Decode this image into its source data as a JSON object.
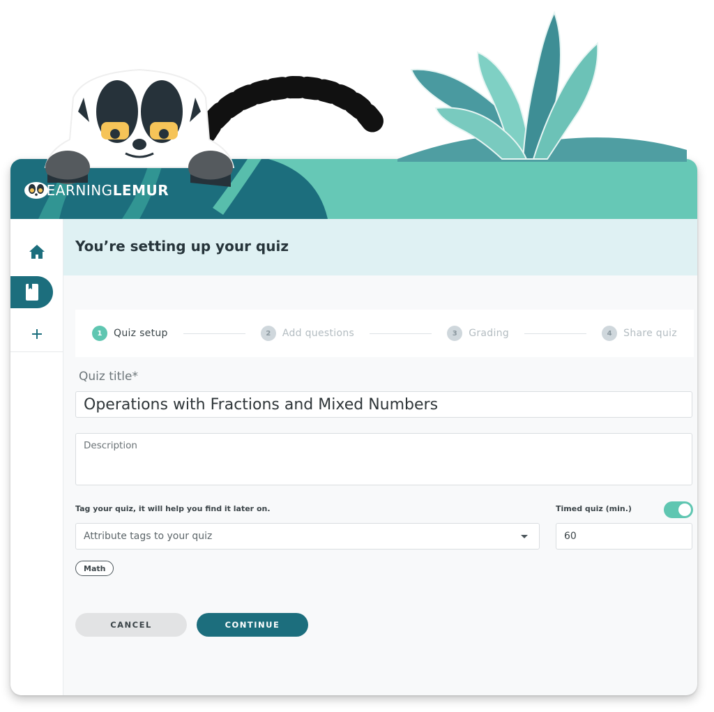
{
  "brand": {
    "name_light": "LEARNING",
    "name_bold": "LEMUR",
    "logo_icon": "lemur-face-icon"
  },
  "colors": {
    "primary": "#1c6e7d",
    "accent": "#5fc6b1",
    "header_bg": "#66c8b6",
    "page_header_bg": "#dff1f3"
  },
  "sidebar": {
    "items": [
      {
        "name": "home",
        "icon": "home-icon",
        "active": false
      },
      {
        "name": "quizzes",
        "icon": "book-icon",
        "active": true
      },
      {
        "name": "add",
        "icon": "plus-icon",
        "active": false
      }
    ]
  },
  "page": {
    "title": "You’re setting up your quiz"
  },
  "stepper": {
    "steps": [
      {
        "number": "1",
        "label": "Quiz setup",
        "active": true
      },
      {
        "number": "2",
        "label": "Add questions",
        "active": false
      },
      {
        "number": "3",
        "label": "Grading",
        "active": false
      },
      {
        "number": "4",
        "label": "Share quiz",
        "active": false
      }
    ]
  },
  "form": {
    "title_label": "Quiz title*",
    "title_value": "Operations with Fractions and Mixed Numbers",
    "description_placeholder": "Description",
    "tag_label": "Tag your quiz, it will help you find it later on.",
    "tag_placeholder": "Attribute tags to your quiz",
    "tags": [
      "Math"
    ],
    "timed_label": "Timed quiz (min.)",
    "timed_enabled": true,
    "timed_value": "60"
  },
  "actions": {
    "cancel_label": "CANCEL",
    "continue_label": "CONTINUE"
  }
}
